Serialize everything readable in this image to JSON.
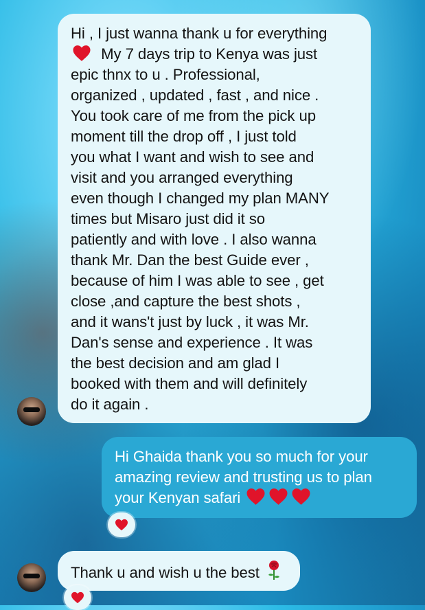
{
  "messages": [
    {
      "sender": "received",
      "lines": [
        "Hi , I just wanna thank u for everything",
        "My 7 days trip to Kenya was just",
        "epic thnx to u . Professional,",
        "organized , updated , fast , and nice .",
        "You took care of me from the pick up",
        "moment till the drop off , I just told",
        "you what I want and wish to see and",
        "visit and you arranged everything",
        "even though I changed my plan MANY",
        "times but Misaro just did it so",
        "patiently and with love . I also wanna",
        "thank Mr. Dan the best Guide ever ,",
        "because of him I was able to see , get",
        "close ,and capture the best shots ,",
        "and it wans't just by luck , it was Mr.",
        "Dan's sense and experience . It was",
        "the best decision and am glad I",
        "booked with them and will definitely",
        "do it again ."
      ],
      "inline_emoji": "red-heart"
    },
    {
      "sender": "sent",
      "lines": [
        "Hi Ghaida thank you so much for your",
        "amazing review and trusting us to plan",
        "your Kenyan safari"
      ],
      "trailing_emojis": [
        "red-heart",
        "red-heart",
        "red-heart"
      ],
      "reaction": "red-heart"
    },
    {
      "sender": "received",
      "lines": [
        "Thank u and wish u the best"
      ],
      "trailing_emoji": "rose",
      "reaction": "red-heart"
    }
  ],
  "colors": {
    "received_bubble": "#e6f7fb",
    "sent_bubble": "#2aa8d4",
    "heart": "#e0142a"
  }
}
